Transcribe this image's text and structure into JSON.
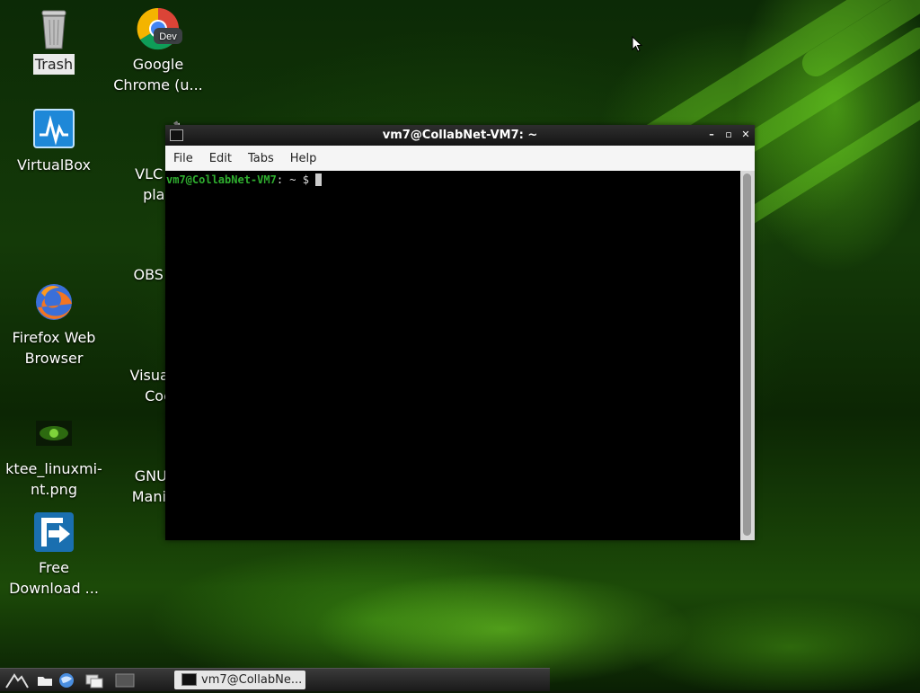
{
  "desktop": {
    "icons": [
      {
        "name": "trash",
        "label": "Trash"
      },
      {
        "name": "google-chrome",
        "label": "Google Chrome (u...",
        "line1": "Google",
        "line2": "Chrome (u...",
        "badge": "Dev"
      },
      {
        "name": "virtualbox",
        "label": "VirtualBox"
      },
      {
        "name": "vlc",
        "line1": "VLC m",
        "line2": "play"
      },
      {
        "name": "obs",
        "line1": "OBS St"
      },
      {
        "name": "firefox",
        "line1": "Firefox Web",
        "line2": "Browser"
      },
      {
        "name": "vscode",
        "line1": "Visual S",
        "line2": "Coc"
      },
      {
        "name": "image-file",
        "line1": "ktee_linuxmi-",
        "line2": "nt.png"
      },
      {
        "name": "gimp",
        "line1": "GNU Ir",
        "line2": "Manipu"
      },
      {
        "name": "free-download-manager",
        "line1": "Free",
        "line2": "Download ..."
      }
    ]
  },
  "terminal": {
    "title": "vm7@CollabNet-VM7: ~",
    "menu": [
      "File",
      "Edit",
      "Tabs",
      "Help"
    ],
    "prompt_user": "vm7@CollabNet-VM7",
    "prompt_rest": ": ~ $",
    "buttons": {
      "minimize": "–",
      "maximize": "▫",
      "close": "✕"
    }
  },
  "taskbar": {
    "active_task": "vm7@CollabNe..."
  },
  "colors": {
    "prompt_green": "#2fae2f",
    "wallpaper_green": "#6ad41e"
  }
}
